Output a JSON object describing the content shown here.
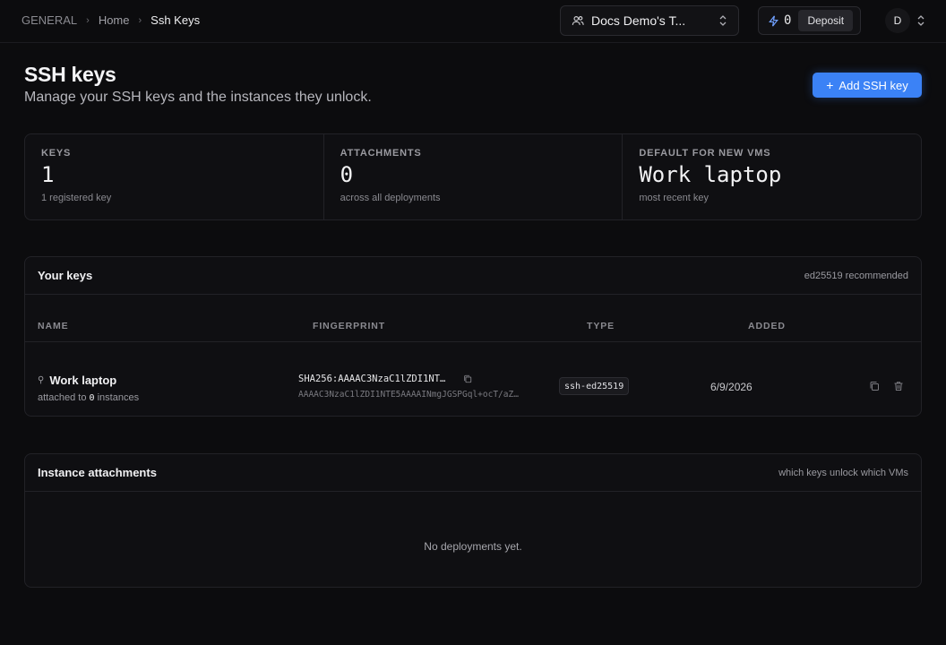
{
  "breadcrumb": {
    "section": "GENERAL",
    "home": "Home",
    "current": "Ssh Keys"
  },
  "topbar": {
    "team_name": "Docs Demo's T...",
    "credits": "0",
    "deposit_label": "Deposit",
    "avatar_initial": "D"
  },
  "header": {
    "title": "SSH keys",
    "subtitle": "Manage your SSH keys and the instances they unlock.",
    "add_button_label": "Add SSH key"
  },
  "stats": [
    {
      "label": "KEYS",
      "value": "1",
      "note": "1 registered key"
    },
    {
      "label": "ATTACHMENTS",
      "value": "0",
      "note": "across all deployments"
    },
    {
      "label": "DEFAULT FOR NEW VMS",
      "value": "Work laptop",
      "note": "most recent key"
    }
  ],
  "keys_card": {
    "title": "Your keys",
    "hint": "ed25519 recommended",
    "columns": [
      "NAME",
      "FINGERPRINT",
      "TYPE",
      "ADDED"
    ],
    "rows": [
      {
        "name": "Work laptop",
        "attached_prefix": "attached to",
        "attached_count": "0",
        "attached_suffix": "instances",
        "fingerprint": "SHA256:AAAAC3NzaC1lZDI1NT…",
        "public_key": "AAAAC3NzaC1lZDI1NTE5AAAAINmgJGSPGql+ocT/aZ…",
        "type": "ssh-ed25519",
        "added": "6/9/2026"
      }
    ]
  },
  "attachments_card": {
    "title": "Instance attachments",
    "hint": "which keys unlock which VMs",
    "empty_message": "No deployments yet."
  },
  "colors": {
    "background": "#0c0c0e",
    "accent": "#3b82f6",
    "card": "#0f0f12",
    "border": "#222227"
  }
}
